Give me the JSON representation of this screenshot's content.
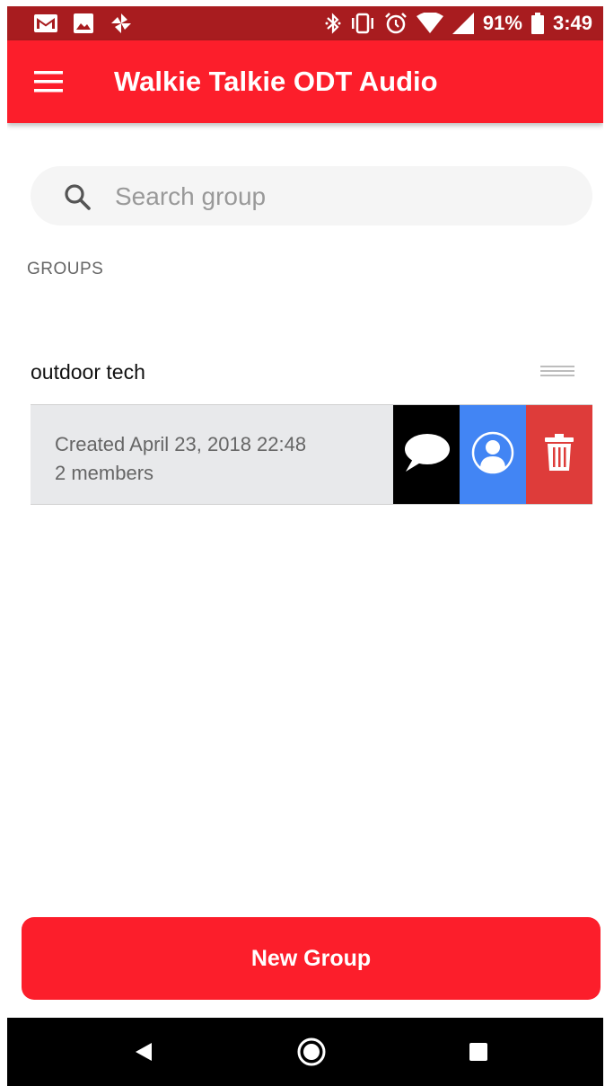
{
  "status_bar": {
    "battery_percent": "91%",
    "time": "3:49",
    "left_icons": [
      "gmail-icon",
      "image-icon",
      "pinwheel-icon"
    ],
    "right_icons": [
      "bluetooth-icon",
      "vibrate-icon",
      "alarm-icon",
      "wifi-icon",
      "signal-icon",
      "battery-icon"
    ]
  },
  "app_bar": {
    "title": "Walkie Talkie ODT Audio",
    "menu_icon": "hamburger-menu-icon"
  },
  "search": {
    "placeholder": "Search group",
    "value": ""
  },
  "groups_section": {
    "label": "GROUPS",
    "groups": [
      {
        "name": "outdoor tech",
        "created": "Created April 23, 2018 22:48",
        "members": "2 members",
        "actions": [
          "chat-bubble-icon",
          "user-profile-icon",
          "trash-icon"
        ]
      }
    ]
  },
  "new_group_button": {
    "label": "New Group"
  },
  "nav_bar": {
    "buttons": [
      "back-icon",
      "home-icon",
      "recents-icon"
    ]
  },
  "colors": {
    "status_bar": "#a81c1f",
    "app_bar": "#fc1e2b",
    "chat_action": "#000000",
    "members_action": "#4285f4",
    "delete_action": "#de3c3a",
    "row_background": "#e8e9eb"
  }
}
